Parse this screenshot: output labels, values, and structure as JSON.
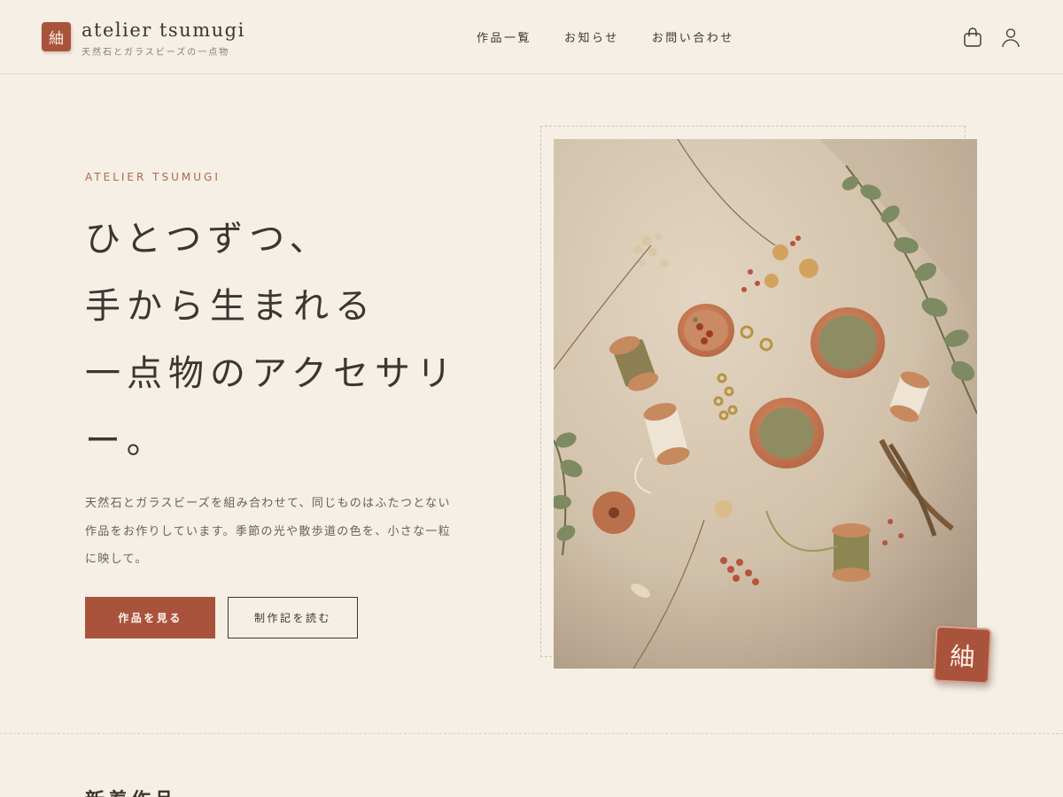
{
  "header": {
    "logo_mark": "紬",
    "brand_name": "atelier tsumugi",
    "brand_tagline": "天然石とガラスビーズの一点物",
    "nav": [
      "作品一覧",
      "お知らせ",
      "お問い合わせ"
    ],
    "icons": {
      "cart": "shopping-bag-icon",
      "account": "user-icon"
    }
  },
  "hero": {
    "eyebrow": "ATELIER TSUMUGI",
    "headline_lines": [
      "ひとつずつ、",
      "手から生まれる",
      "一点物のアクセサリ",
      "ー。"
    ],
    "lead": "天然石とガラスビーズを組み合わせて、同じものはふたつとない作品をお作りしています。季節の光や散歩道の色を、小さな一粒に映して。",
    "primary_button": "作品を見る",
    "secondary_button": "制作記を読む",
    "stamp": "紬"
  },
  "next_section": {
    "title": "新着作品"
  },
  "colors": {
    "background": "#f5efe6",
    "accent": "#a9533c",
    "text": "#3b3631",
    "eyebrow": "#b0674a"
  }
}
